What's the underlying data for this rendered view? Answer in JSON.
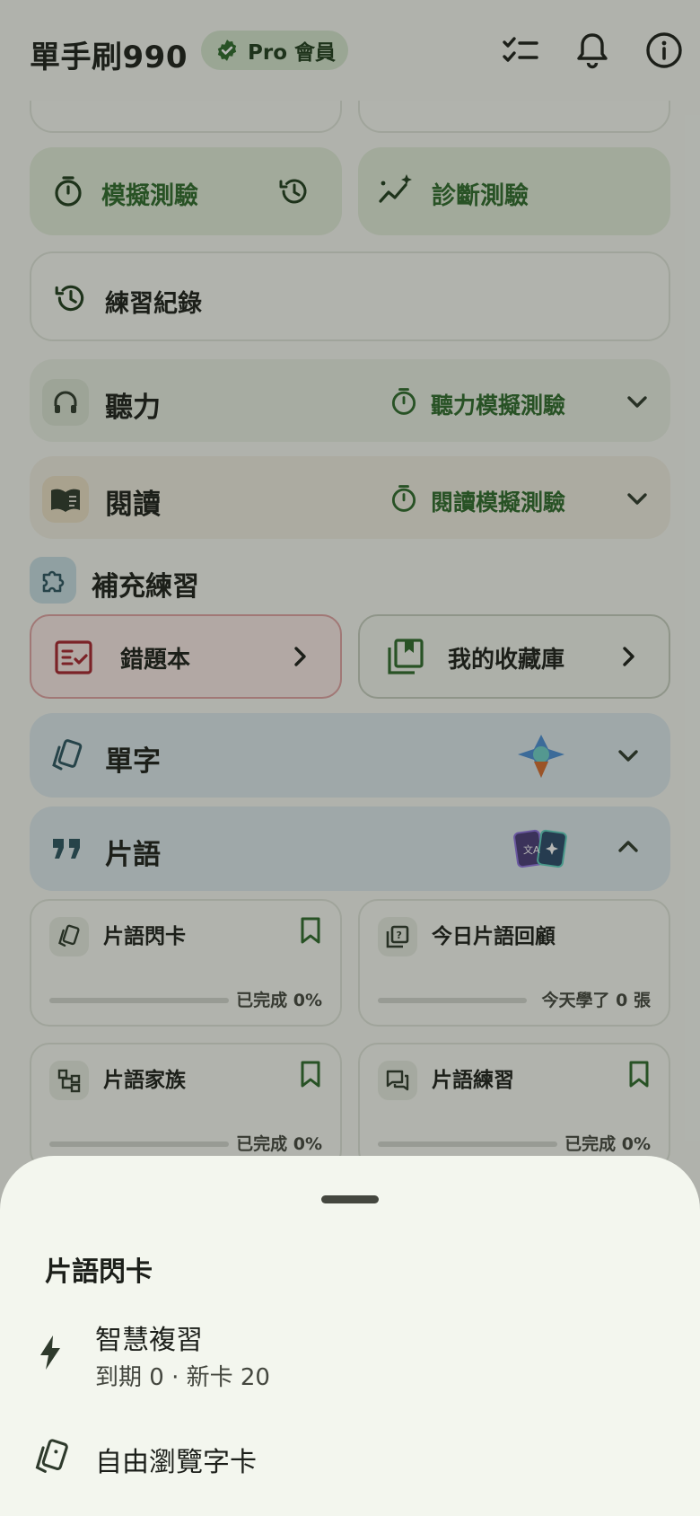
{
  "header": {
    "app_title": "單手刷990",
    "badge_label": "Pro 會員"
  },
  "main": {
    "mock_test_label": "模擬測驗",
    "diagnostic_test_label": "診斷測驗",
    "practice_history_label": "練習紀錄",
    "listening": {
      "label": "聽力",
      "mock_label": "聽力模擬測驗"
    },
    "reading": {
      "label": "閱讀",
      "mock_label": "閱讀模擬測驗"
    },
    "supplementary_title": "補充練習",
    "mistakes_label": "錯題本",
    "favorites_label": "我的收藏庫",
    "vocabulary_label": "單字",
    "phrases_label": "片語",
    "cards": [
      {
        "title": "片語閃卡",
        "progress": "已完成 0%",
        "bookmark": true
      },
      {
        "title": "今日片語回顧",
        "progress": "今天學了 0 張",
        "bookmark": false
      },
      {
        "title": "片語家族",
        "progress": "已完成 0%",
        "bookmark": true
      },
      {
        "title": "片語練習",
        "progress": "已完成 0%",
        "bookmark": true
      }
    ]
  },
  "sheet": {
    "title": "片語閃卡",
    "smart_review_title": "智慧複習",
    "smart_review_sub": "到期 0 · 新卡 20",
    "browse_title": "自由瀏覽字卡"
  },
  "colors": {
    "accent_green": "#2f6a2b",
    "mistakes_red": "#a8242e",
    "sheet_bg": "#f3f6ee"
  }
}
